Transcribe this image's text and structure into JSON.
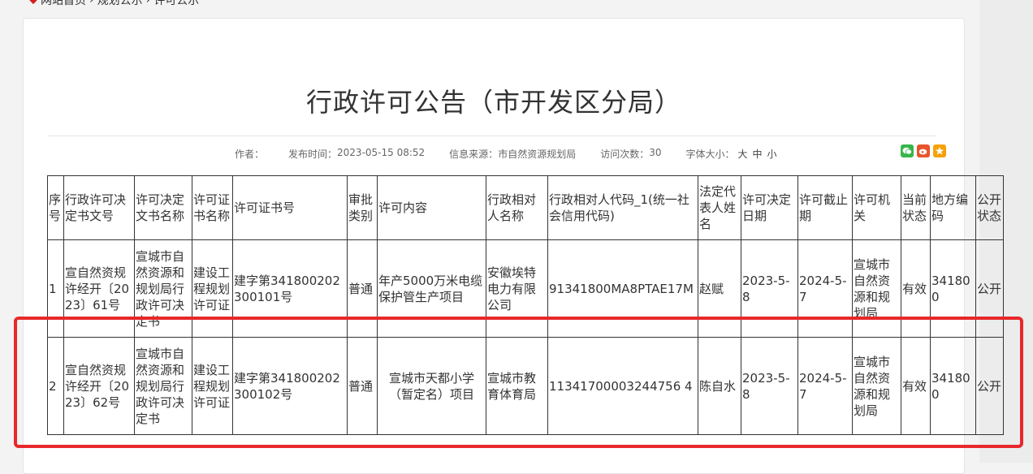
{
  "breadcrumb": {
    "items": [
      "网站首页",
      "规划公示",
      "许可公示"
    ],
    "separator": "›"
  },
  "article": {
    "title": "行政许可公告（市开发区分局）",
    "meta": {
      "author_label": "作者：",
      "author": "",
      "publish_label": "发布时间：",
      "publish_time": "2023-05-15 08:52",
      "source_label": "信息来源：",
      "source": "市自然资源规划局",
      "visits_label": "访问次数：",
      "visits": "30",
      "font_size_label": "字体大小：",
      "font_sizes": [
        "大",
        "中",
        "小"
      ]
    },
    "share_icons": [
      "wechat-icon",
      "weibo-icon",
      "star-icon"
    ]
  },
  "table": {
    "headers": [
      "序号",
      "行政许可决定书文号",
      "许可决定文书名称",
      "许可证书名称",
      "许可证书号",
      "审批类别",
      "许可内容",
      "行政相对人名称",
      "行政相对人代码_1(统一社会信用代码)",
      "法定代表人姓名",
      "许可决定日期",
      "许可截止期",
      "许可机关",
      "当前状态",
      "地方编码",
      "公开状态"
    ],
    "rows": [
      [
        "1",
        "宣自然资规许经开〔2023〕61号",
        "宣城市自然资源和规划局行政许可决定书",
        "建设工程规划许可证",
        "建字第341800202300101号",
        "普通",
        "年产5000万米电缆保护管生产项目",
        "安徽埃特电力有限公司",
        "91341800MA8PTAE17M",
        "赵赋",
        "2023-5-8",
        "2024-5-7",
        "宣城市自然资源和规划局",
        "有效",
        "341800",
        "公开"
      ],
      [
        "2",
        "宣自然资规许经开〔2023〕62号",
        "宣城市自然资源和规划局行政许可决定书",
        "建设工程规划许可证",
        "建字第341800202300102号",
        "普通",
        "宣城市天都小学（暂定名）项目",
        "宣城市教育体育局",
        "11341700003244756 4",
        "陈自水",
        "2023-5-8",
        "2024-5-7",
        "宣城市自然资源和规划局",
        "有效",
        "341800",
        "公开"
      ]
    ]
  },
  "colors": {
    "highlight": "#e8282b",
    "breadcrumb_pin": "#d42020"
  }
}
